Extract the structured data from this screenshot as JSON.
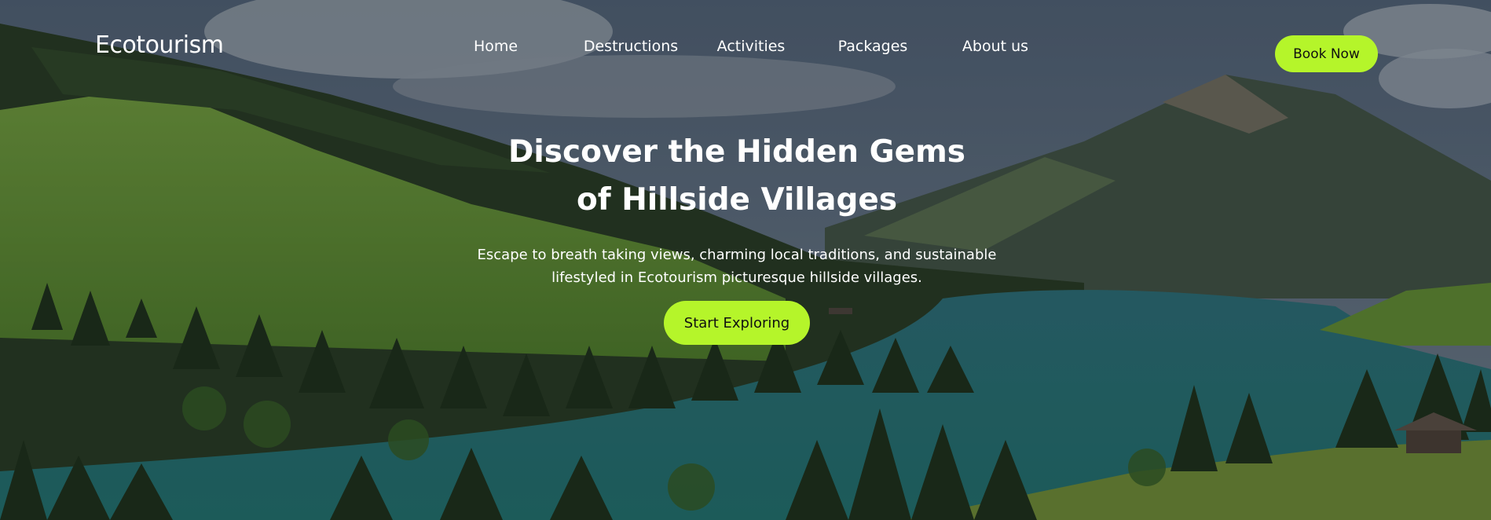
{
  "brand": {
    "logo_text": "Ecotourism"
  },
  "nav": {
    "items": [
      {
        "label": "Home"
      },
      {
        "label": "Destructions"
      },
      {
        "label": "Activities"
      },
      {
        "label": "Packages"
      },
      {
        "label": "About us"
      }
    ],
    "book_label": "Book Now"
  },
  "hero": {
    "headline_line1": "Discover the Hidden Gems",
    "headline_line2": "of Hillside Villages",
    "subtitle_line1": "Escape to breath taking views, charming local traditions, and sustainable",
    "subtitle_line2": "lifestyled in Ecotourism picturesque hillside villages.",
    "cta_label": "Start Exploring",
    "background": "mountain-lake-forest-photo"
  },
  "colors": {
    "accent": "#b5f52a",
    "text": "#ffffff",
    "button_text": "#111111"
  }
}
